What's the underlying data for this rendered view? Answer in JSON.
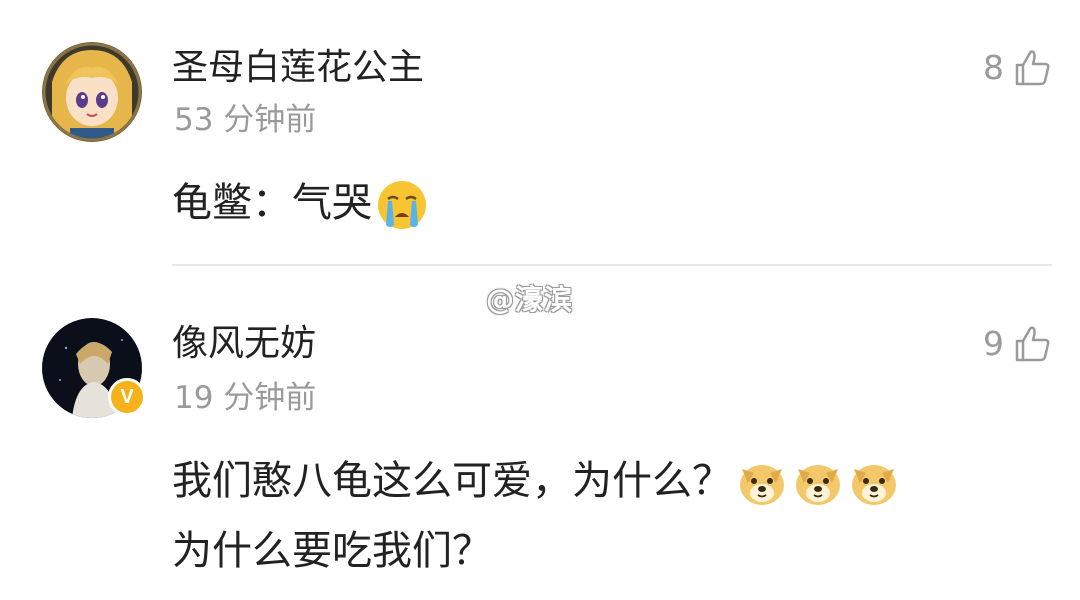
{
  "watermark": "@濠滨",
  "comments": [
    {
      "username": "圣母白莲花公主",
      "time": "53 分钟前",
      "likes": "8",
      "text_lines": [
        "龟鳖：气哭"
      ],
      "emojis": [
        "crying-face-emoji"
      ]
    },
    {
      "username": "像风无妨",
      "time": "19 分钟前",
      "likes": "9",
      "verified_badge": "V",
      "text_lines": [
        "我们憨八龟这么可爱，为什么？",
        "为什么要吃我们？"
      ],
      "emojis": [
        "doge-emoji",
        "doge-emoji",
        "doge-emoji"
      ]
    }
  ],
  "colors": {
    "text": "#222222",
    "meta": "#9a9a9a",
    "divider": "#e8e8e8",
    "badge": "#f6b21a"
  }
}
